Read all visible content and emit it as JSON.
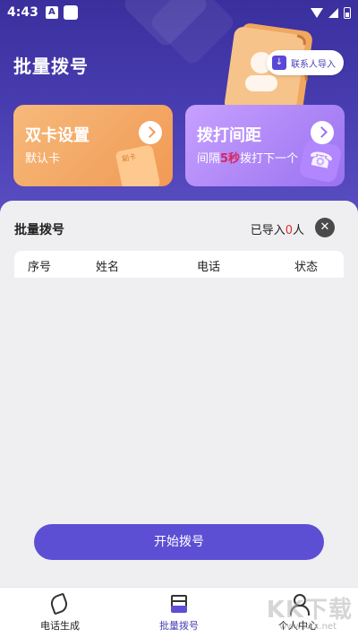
{
  "status_bar": {
    "time": "4:43",
    "icon_a": "A"
  },
  "header": {
    "title": "批量拨号",
    "import_button_label": "联系人导入"
  },
  "cards": {
    "dual_sim": {
      "title": "双卡设置",
      "subtitle": "默认卡",
      "deco_label": "副卡"
    },
    "interval": {
      "title": "拨打间距",
      "subtitle_prefix": "间隔",
      "interval_value": "5秒",
      "subtitle_suffix": "拨打下一个"
    }
  },
  "list": {
    "title": "批量拨号",
    "imported_prefix": "已导入",
    "imported_count": "0",
    "imported_suffix": "人",
    "columns": [
      "序号",
      "姓名",
      "电话",
      "状态"
    ]
  },
  "start_button_label": "开始拨号",
  "bottom_nav": {
    "items": [
      {
        "label": "电话生成",
        "icon": "phone-icon",
        "active": false
      },
      {
        "label": "批量拨号",
        "icon": "layers-icon",
        "active": true
      },
      {
        "label": "个人中心",
        "icon": "person-icon",
        "active": false
      }
    ]
  },
  "watermark": {
    "main": "KK下载",
    "sub": "www.kkx.net"
  },
  "colors": {
    "primary": "#5c4fd4",
    "header_bg": "#3a2f9d",
    "accent_red": "#e02e2e",
    "orange_card": "#f19a55",
    "purple_card": "#9a72f0"
  }
}
